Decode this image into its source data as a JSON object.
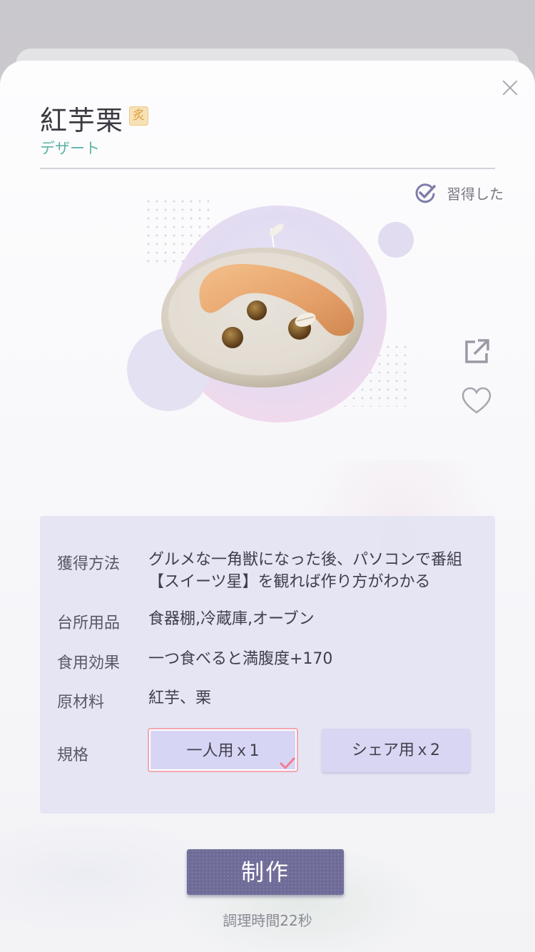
{
  "recipe": {
    "name": "紅芋栗",
    "tool_badge": "炙",
    "category": "デザート",
    "learned_label": "習得した"
  },
  "details": {
    "acquire": {
      "label": "獲得方法",
      "value": "グルメな一角獣になった後、パソコンで番組【スイーツ星】を観れば作り方がわかる"
    },
    "kitchen": {
      "label": "台所用品",
      "value": "食器棚,冷蔵庫,オーブン"
    },
    "effect": {
      "label": "食用効果",
      "value": "一つ食べると満腹度+170"
    },
    "ingredients": {
      "label": "原材料",
      "value": "紅芋、栗"
    },
    "size": {
      "label": "規格"
    }
  },
  "size_options": [
    {
      "label": "一人用ｘ1",
      "selected": true
    },
    {
      "label": "シェア用ｘ2",
      "selected": false
    }
  ],
  "actions": {
    "make_label": "制作",
    "cook_time": "調理時間22秒"
  },
  "icons": {
    "close": "close-icon",
    "learned": "check-circle-icon",
    "share": "share-icon",
    "favorite": "heart-icon",
    "selected": "checkmark-icon"
  },
  "colors": {
    "accent_teal": "#5fb3a6",
    "panel_bg": "#e4e4f2",
    "make_button": "#6e6b98",
    "selected_border": "#f2a7b4"
  }
}
